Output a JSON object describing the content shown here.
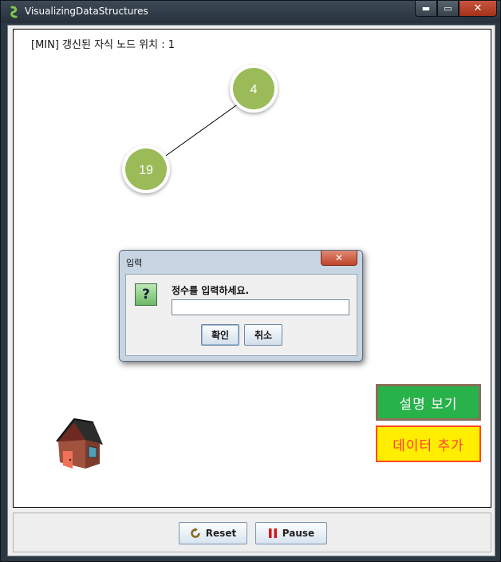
{
  "window": {
    "title": "VisualizingDataStructures",
    "min_symbol": "▬",
    "max_symbol": "▭",
    "close_symbol": "✕"
  },
  "canvas": {
    "status": "[MIN] 갱신된 자식 노드 위치 : 1",
    "nodes": [
      {
        "value": "4",
        "role": "root"
      },
      {
        "value": "19",
        "role": "left-child"
      }
    ],
    "node_color": "#9bbb59"
  },
  "side_buttons": {
    "explain_label": "설명 보기",
    "add_label": "데이터 추가"
  },
  "controls": {
    "reset_label": "Reset",
    "pause_label": "Pause",
    "reset_icon": "reset-icon",
    "pause_icon": "pause-icon"
  },
  "dialog": {
    "title": "입력",
    "close_symbol": "✕",
    "icon_glyph": "?",
    "message": "정수를 입력하세요.",
    "input_value": "",
    "ok_label": "확인",
    "cancel_label": "취소"
  }
}
